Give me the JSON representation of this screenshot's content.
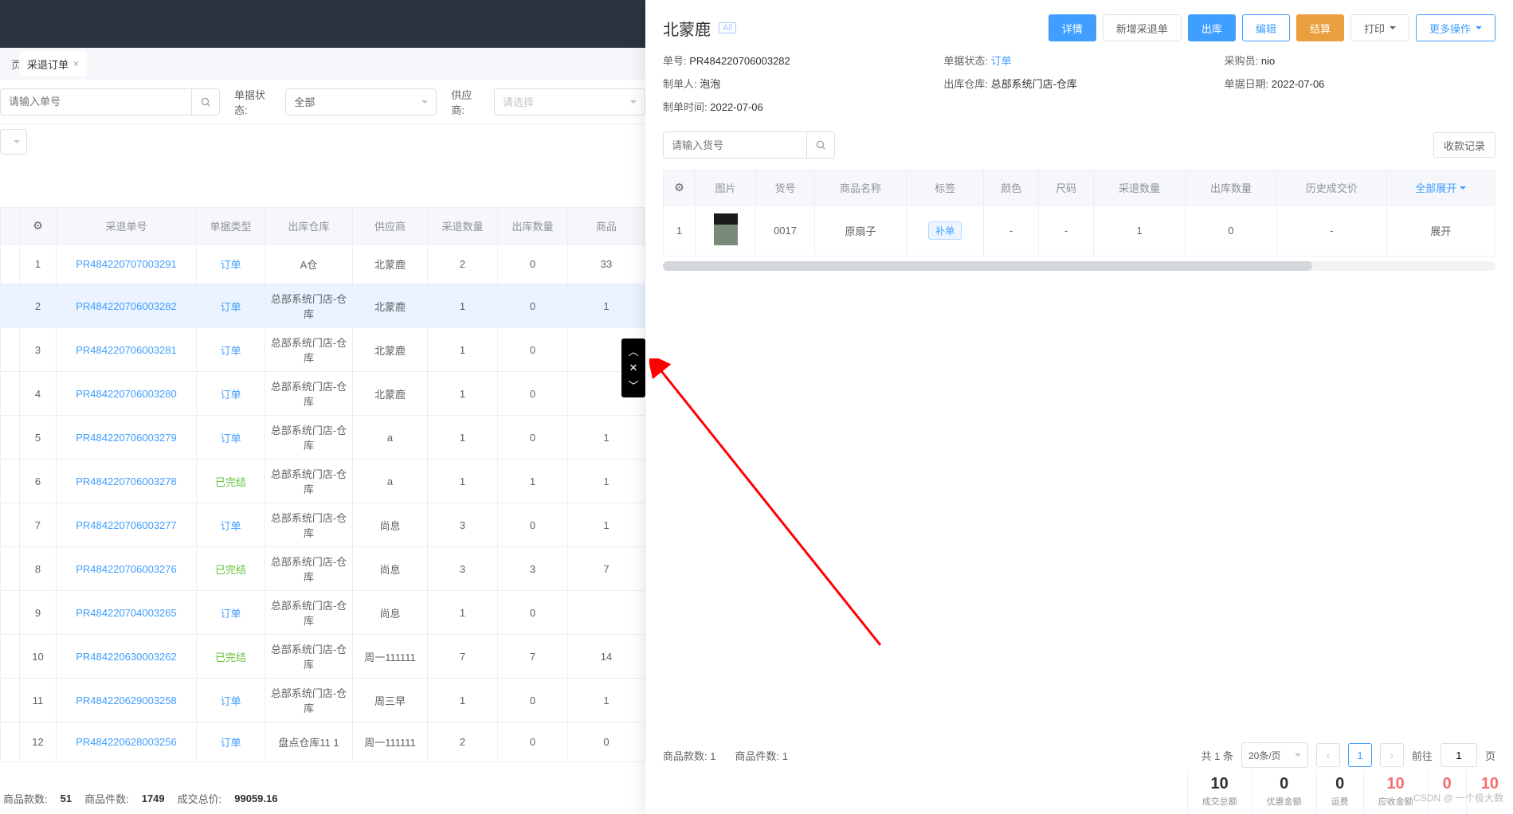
{
  "tabs": {
    "home": "页",
    "active": "采退订单"
  },
  "filters": {
    "search_placeholder": "请输入单号",
    "status_label": "单据状态:",
    "status_value": "全部",
    "supplier_label": "供应商:",
    "supplier_placeholder": "请选择"
  },
  "left_headers": [
    "",
    "",
    "采退单号",
    "单据类型",
    "出库仓库",
    "供应商",
    "采退数量",
    "出库数量",
    "商品"
  ],
  "left_rows": [
    {
      "idx": "1",
      "no": "PR484220707003291",
      "type": "订单",
      "type_cls": "status-order",
      "wh": "A仓",
      "sup": "北蒙鹿",
      "qty": "2",
      "out": "0",
      "g": "33"
    },
    {
      "idx": "2",
      "no": "PR484220706003282",
      "type": "订单",
      "type_cls": "status-order",
      "wh": "总部系统门店-仓库",
      "sup": "北蒙鹿",
      "qty": "1",
      "out": "0",
      "g": "1",
      "selected": true
    },
    {
      "idx": "3",
      "no": "PR484220706003281",
      "type": "订单",
      "type_cls": "status-order",
      "wh": "总部系统门店-仓库",
      "sup": "北蒙鹿",
      "qty": "1",
      "out": "0",
      "g": ""
    },
    {
      "idx": "4",
      "no": "PR484220706003280",
      "type": "订单",
      "type_cls": "status-order",
      "wh": "总部系统门店-仓库",
      "sup": "北蒙鹿",
      "qty": "1",
      "out": "0",
      "g": ""
    },
    {
      "idx": "5",
      "no": "PR484220706003279",
      "type": "订单",
      "type_cls": "status-order",
      "wh": "总部系统门店-仓库",
      "sup": "a",
      "qty": "1",
      "out": "0",
      "g": "1"
    },
    {
      "idx": "6",
      "no": "PR484220706003278",
      "type": "已完结",
      "type_cls": "status-done",
      "wh": "总部系统门店-仓库",
      "sup": "a",
      "qty": "1",
      "out": "1",
      "g": "1"
    },
    {
      "idx": "7",
      "no": "PR484220706003277",
      "type": "订单",
      "type_cls": "status-order",
      "wh": "总部系统门店-仓库",
      "sup": "尚息",
      "qty": "3",
      "out": "0",
      "g": "1"
    },
    {
      "idx": "8",
      "no": "PR484220706003276",
      "type": "已完结",
      "type_cls": "status-done",
      "wh": "总部系统门店-仓库",
      "sup": "尚息",
      "qty": "3",
      "out": "3",
      "g": "7"
    },
    {
      "idx": "9",
      "no": "PR484220704003265",
      "type": "订单",
      "type_cls": "status-order",
      "wh": "总部系统门店-仓库",
      "sup": "尚息",
      "qty": "1",
      "out": "0",
      "g": ""
    },
    {
      "idx": "10",
      "no": "PR484220630003262",
      "type": "已完结",
      "type_cls": "status-done",
      "wh": "总部系统门店-仓库",
      "sup": "周一111111",
      "qty": "7",
      "out": "7",
      "g": "14"
    },
    {
      "idx": "11",
      "no": "PR484220629003258",
      "type": "订单",
      "type_cls": "status-order",
      "wh": "总部系统门店-仓库",
      "sup": "周三早",
      "qty": "1",
      "out": "0",
      "g": "1"
    },
    {
      "idx": "12",
      "no": "PR484220628003256",
      "type": "订单",
      "type_cls": "status-order",
      "wh": "盘点仓库11 1",
      "sup": "周一111111",
      "qty": "2",
      "out": "0",
      "g": "0"
    }
  ],
  "footer": {
    "sku_label": "商品款数:",
    "sku_val": "51",
    "piece_label": "商品件数:",
    "piece_val": "1749",
    "total_label": "成交总价:",
    "total_val": "99059.16"
  },
  "detail": {
    "title": "北蒙鹿",
    "all_tag": "All",
    "actions": {
      "detail": "详情",
      "new_return": "新增采退单",
      "out": "出库",
      "edit": "编辑",
      "settle": "结算",
      "print": "打印",
      "more": "更多操作"
    },
    "meta": {
      "no_l": "单号:",
      "no_v": "PR484220706003282",
      "status_l": "单据状态:",
      "status_v": "订单",
      "buyer_l": "采购员:",
      "buyer_v": "nio",
      "maker_l": "制单人:",
      "maker_v": "泡泡",
      "wh_l": "出库仓库:",
      "wh_v": "总部系统门店-仓库",
      "date_l": "单据日期:",
      "date_v": "2022-07-06",
      "time_l": "制单时间:",
      "time_v": "2022-07-06"
    },
    "item_search_placeholder": "请输入货号",
    "receipt_log": "收款记录",
    "headers": [
      "",
      "图片",
      "货号",
      "商品名称",
      "标签",
      "颜色",
      "尺码",
      "采退数量",
      "出库数量",
      "历史成交价",
      ""
    ],
    "expand_all": "全部展开",
    "row": {
      "idx": "1",
      "sku": "0017",
      "name": "原扇子",
      "tag": "补单",
      "color": "-",
      "size": "-",
      "qty": "1",
      "out": "0",
      "hist": "-",
      "expand": "展开"
    },
    "bottom": {
      "sku_l": "商品款数:",
      "sku_v": "1",
      "piece_l": "商品件数:",
      "piece_v": "1",
      "total_text": "共 1 条",
      "page_size": "20条/页",
      "goto": "前往",
      "goto_val": "1",
      "page_suffix": "页",
      "current": "1"
    },
    "totals": [
      {
        "num": "10",
        "lbl": "成交总额",
        "red": false
      },
      {
        "num": "0",
        "lbl": "优惠金额",
        "red": false
      },
      {
        "num": "0",
        "lbl": "运费",
        "red": false
      },
      {
        "num": "10",
        "lbl": "应收金额",
        "red": true
      },
      {
        "num": "0",
        "lbl": "",
        "red": true
      },
      {
        "num": "10",
        "lbl": "",
        "red": true
      }
    ]
  },
  "watermark": "CSDN @ 一个极大数"
}
